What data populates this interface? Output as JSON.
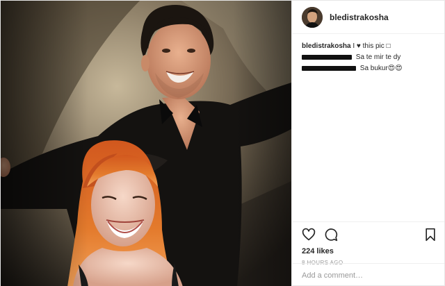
{
  "post": {
    "username": "bledistrakosha",
    "caption": "I ♥ this pic □",
    "comments": [
      {
        "author_redacted": true,
        "text": "Sa te mir te dy"
      },
      {
        "author_redacted": true,
        "text": "Sa bukur😍😍"
      }
    ],
    "likes": "224 likes",
    "time": "8 HOURS AGO",
    "comment_placeholder": "Add a comment…"
  },
  "icons": {
    "like": "heart-icon",
    "comment": "comment-bubble-icon",
    "save": "bookmark-icon"
  },
  "colors": {
    "text": "#262626",
    "muted": "#999999",
    "border": "#efefef",
    "redaction": "#111111"
  }
}
